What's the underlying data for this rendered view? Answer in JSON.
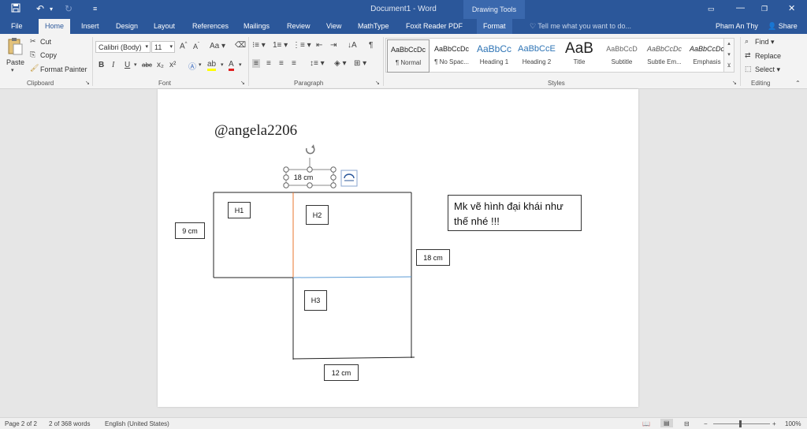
{
  "titlebar": {
    "title": "Document1 - Word",
    "context_tab": "Drawing Tools",
    "icons": [
      "save-icon",
      "undo-icon",
      "redo-icon",
      "customize-icon",
      "ribbon-options-icon",
      "minimize-icon",
      "restore-icon",
      "close-icon"
    ]
  },
  "tabs": [
    "File",
    "Home",
    "Insert",
    "Design",
    "Layout",
    "References",
    "Mailings",
    "Review",
    "View",
    "MathType",
    "Foxit Reader PDF",
    "Format"
  ],
  "active_tab": "Home",
  "tell_me": "Tell me what you want to do...",
  "user": "Pham An Thy",
  "share": "Share",
  "clipboard": {
    "paste": "Paste",
    "cut": "Cut",
    "copy": "Copy",
    "format_painter": "Format Painter",
    "label": "Clipboard"
  },
  "font": {
    "name": "Calibri (Body)",
    "size": "11",
    "label": "Font",
    "buttons": [
      "B",
      "I",
      "U",
      "abc",
      "x₂",
      "x²"
    ],
    "case_btn": "Aa"
  },
  "paragraph": {
    "label": "Paragraph"
  },
  "styles": {
    "label": "Styles",
    "items": [
      {
        "sample": "AaBbCcDc",
        "name": "¶ Normal"
      },
      {
        "sample": "AaBbCcDc",
        "name": "¶ No Spac..."
      },
      {
        "sample": "AaBbCc",
        "name": "Heading 1"
      },
      {
        "sample": "AaBbCcE",
        "name": "Heading 2"
      },
      {
        "sample": "AaB",
        "name": "Title"
      },
      {
        "sample": "AaBbCcD",
        "name": "Subtitle"
      },
      {
        "sample": "AaBbCcDc",
        "name": "Subtle Em..."
      },
      {
        "sample": "AaBbCcDc",
        "name": "Emphasis"
      }
    ]
  },
  "editing": {
    "find": "Find",
    "replace": "Replace",
    "select": "Select",
    "label": "Editing"
  },
  "document": {
    "handle": "@angela2206",
    "labels": {
      "top": "18 cm",
      "left": "9 cm",
      "right": "18 cm",
      "bottom": "12 cm",
      "h1": "H1",
      "h2": "H2",
      "h3": "H3"
    },
    "note": "Mk vẽ hình đại khái như thế nhé !!!",
    "colors": {
      "orange_line": "#e8742c",
      "blue_line": "#5b9bd5",
      "handle": "#2b579a"
    }
  },
  "status": {
    "page": "Page 2 of 2",
    "words": "2 of 368 words",
    "language": "English (United States)",
    "zoom": "100%"
  }
}
